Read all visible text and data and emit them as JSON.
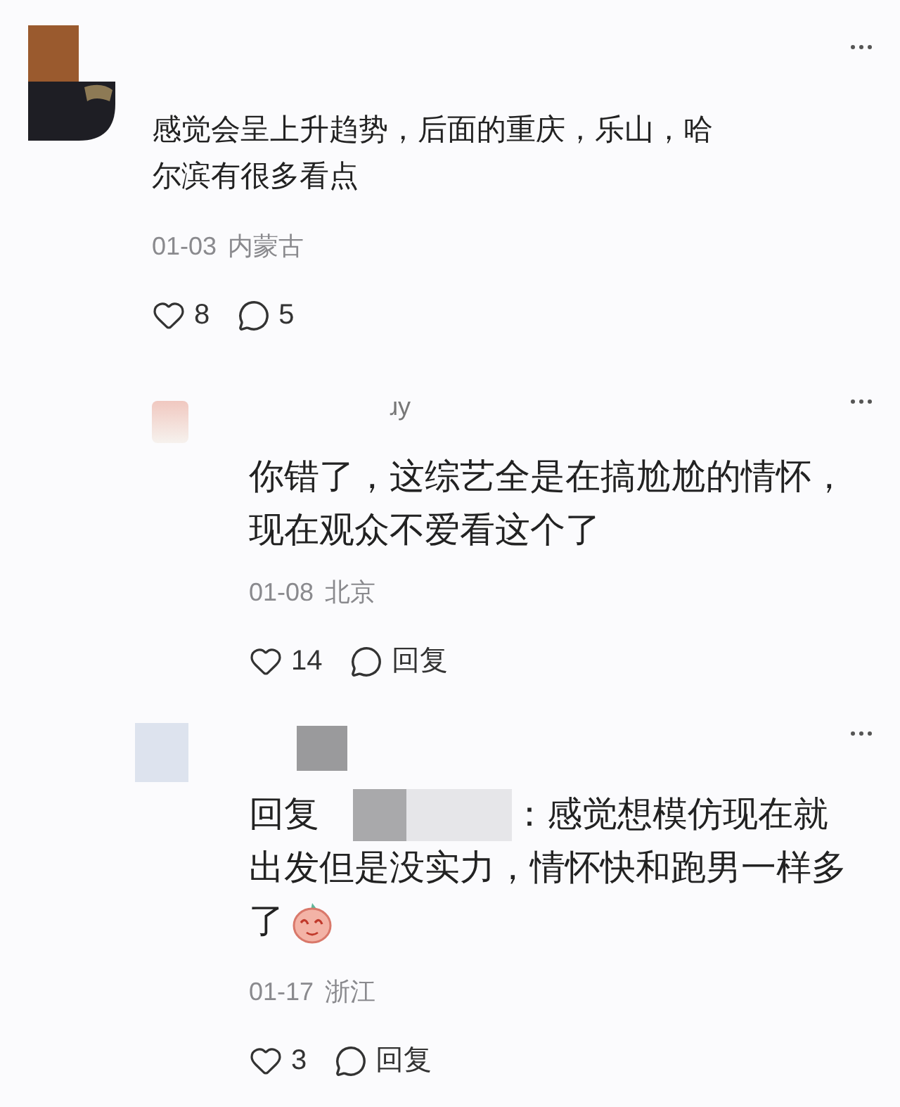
{
  "comments": [
    {
      "kind": "top",
      "body_lines": [
        "感觉会呈上升趋势，后面的重庆，乐山，哈",
        "尔滨有很多看点"
      ],
      "date": "01-03",
      "location": "内蒙古",
      "likes": "8",
      "reply_action": "5"
    },
    {
      "kind": "reply",
      "username": "ɹy",
      "body_lines": [
        "你错了，这综艺全是在搞尬尬的情怀，",
        "现在观众不爱看这个了"
      ],
      "date": "01-08",
      "location": "北京",
      "likes": "14",
      "reply_action": "回复"
    },
    {
      "kind": "reply",
      "redacted_name": true,
      "reply_prefix": "回复",
      "lead_text": "：感觉想模仿现在就",
      "body_lines": [
        "出发但是没实力，情怀快和跑男一样多",
        "了"
      ],
      "emoji": true,
      "date": "01-17",
      "location": "浙江",
      "likes": "3",
      "reply_action": "回复"
    }
  ]
}
